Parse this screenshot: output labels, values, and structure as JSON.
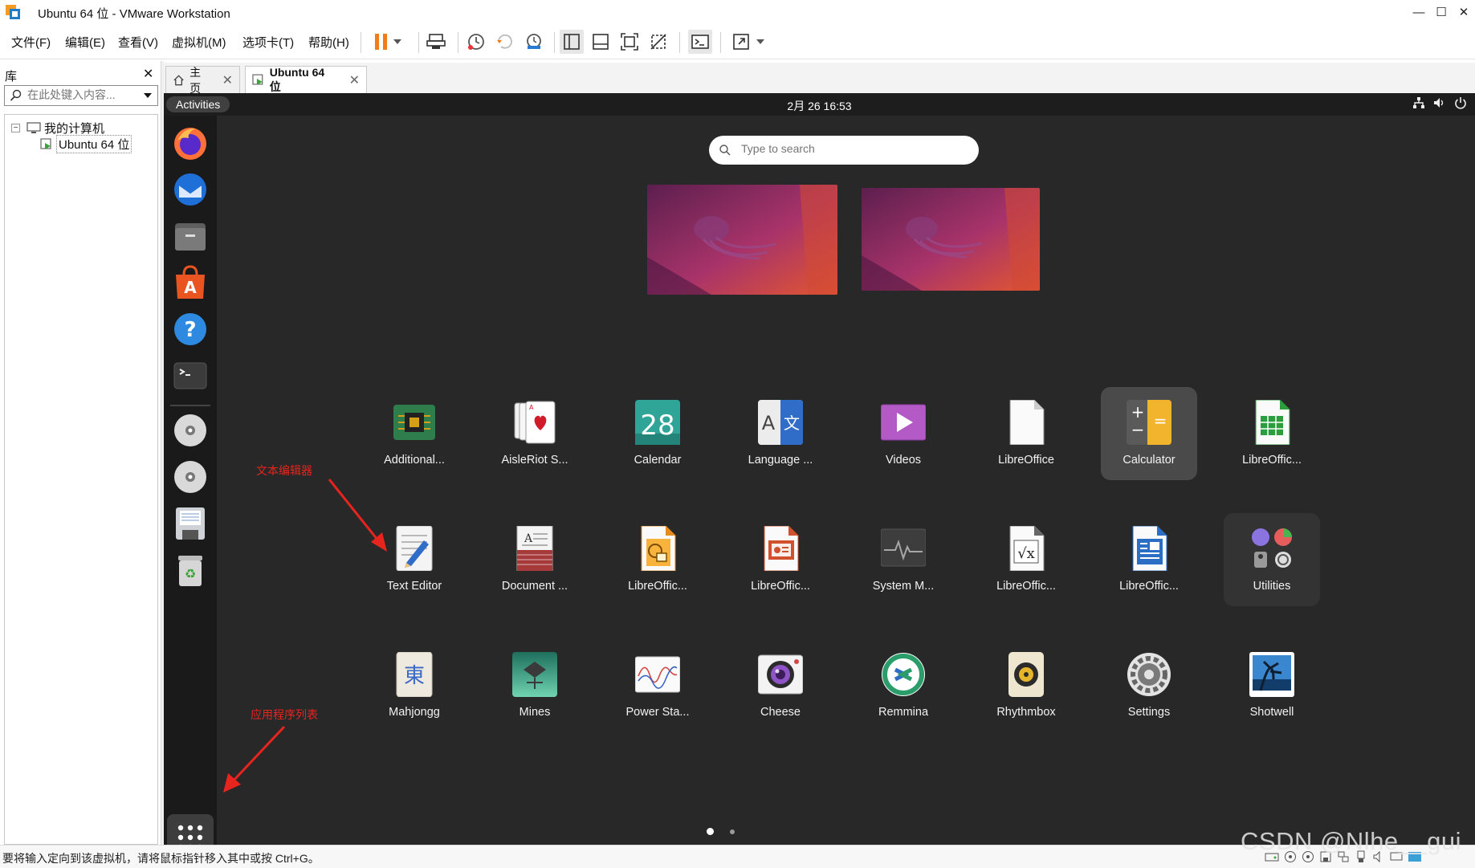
{
  "window": {
    "title": "Ubuntu 64 位 - VMware Workstation",
    "controls": [
      "minimize",
      "maximize",
      "close"
    ]
  },
  "menu": [
    {
      "label": "文件(F)"
    },
    {
      "label": "编辑(E)"
    },
    {
      "label": "查看(V)"
    },
    {
      "label": "虚拟机(M)"
    },
    {
      "label": "选项卡(T)"
    },
    {
      "label": "帮助(H)"
    }
  ],
  "toolbar": {
    "icons": [
      "pause-icon",
      "dropdown-icon",
      "send-ctrl-alt-del-icon",
      "snapshot-take-icon",
      "snapshot-revert-icon",
      "snapshot-manager-icon",
      "library-view-icon",
      "thumbnail-bar-icon",
      "fullscreen-icon",
      "unity-icon",
      "console-view-icon",
      "stretch-icon",
      "stretch-dropdown-icon"
    ]
  },
  "library": {
    "title": "库",
    "search_placeholder": "在此处键入内容...",
    "tree": [
      {
        "label": "我的计算机",
        "level": 0,
        "expanded": true
      },
      {
        "label": "Ubuntu 64 位",
        "level": 1,
        "selected": true
      }
    ]
  },
  "tabs": [
    {
      "label": "主页",
      "active": false
    },
    {
      "label": "Ubuntu 64 位",
      "active": true
    }
  ],
  "ubuntu": {
    "activities": "Activities",
    "clock": "2月 26  16:53",
    "search_placeholder": "Type to search",
    "dock": [
      "firefox-icon",
      "thunderbird-icon",
      "files-icon",
      "app-center-icon",
      "help-icon",
      "terminal-icon",
      "cd-drive-icon",
      "dvd-drive-icon",
      "floppy-icon",
      "trash-icon"
    ],
    "app_grid_button": "show-applications-icon",
    "apps": [
      [
        {
          "label": "Additional...",
          "icon": "additional-drivers-icon"
        },
        {
          "label": "AisleRiot S...",
          "icon": "aisleriot-icon"
        },
        {
          "label": "Calendar",
          "icon": "calendar-icon",
          "day": "28"
        },
        {
          "label": "Language ...",
          "icon": "language-support-icon"
        },
        {
          "label": "Videos",
          "icon": "videos-icon"
        },
        {
          "label": "LibreOffice",
          "icon": "libreoffice-icon"
        },
        {
          "label": "Calculator",
          "icon": "calculator-icon",
          "highlighted": true
        },
        {
          "label": "LibreOffic...",
          "icon": "libreoffice-calc-icon"
        }
      ],
      [
        {
          "label": "Text Editor",
          "icon": "text-editor-icon"
        },
        {
          "label": "Document ...",
          "icon": "document-viewer-icon"
        },
        {
          "label": "LibreOffic...",
          "icon": "libreoffice-draw-icon"
        },
        {
          "label": "LibreOffic...",
          "icon": "libreoffice-impress-icon"
        },
        {
          "label": "System M...",
          "icon": "system-monitor-icon"
        },
        {
          "label": "LibreOffic...",
          "icon": "libreoffice-math-icon"
        },
        {
          "label": "LibreOffic...",
          "icon": "libreoffice-writer-icon"
        },
        {
          "label": "Utilities",
          "icon": "utilities-folder-icon",
          "folder": true
        }
      ],
      [
        {
          "label": "Mahjongg",
          "icon": "mahjongg-icon"
        },
        {
          "label": "Mines",
          "icon": "mines-icon"
        },
        {
          "label": "Power Sta...",
          "icon": "power-statistics-icon"
        },
        {
          "label": "Cheese",
          "icon": "cheese-icon"
        },
        {
          "label": "Remmina",
          "icon": "remmina-icon"
        },
        {
          "label": "Rhythmbox",
          "icon": "rhythmbox-icon"
        },
        {
          "label": "Settings",
          "icon": "settings-icon"
        },
        {
          "label": "Shotwell",
          "icon": "shotwell-icon"
        }
      ]
    ],
    "pages": {
      "current": 1,
      "total": 2
    }
  },
  "annotations": {
    "text_editor_label": "文本编辑器",
    "app_list_label": "应用程序列表"
  },
  "statusbar": {
    "message": "要将输入定向到该虚拟机，请将鼠标指针移入其中或按 Ctrl+G。"
  },
  "watermark": "CSDN @Nlhe__gui",
  "colors": {
    "ubuntu_bg": "#282828",
    "dock_bg": "#1a1a1a",
    "annotation_red": "#e8241e",
    "highlight_tile": "#4a4a4a"
  }
}
